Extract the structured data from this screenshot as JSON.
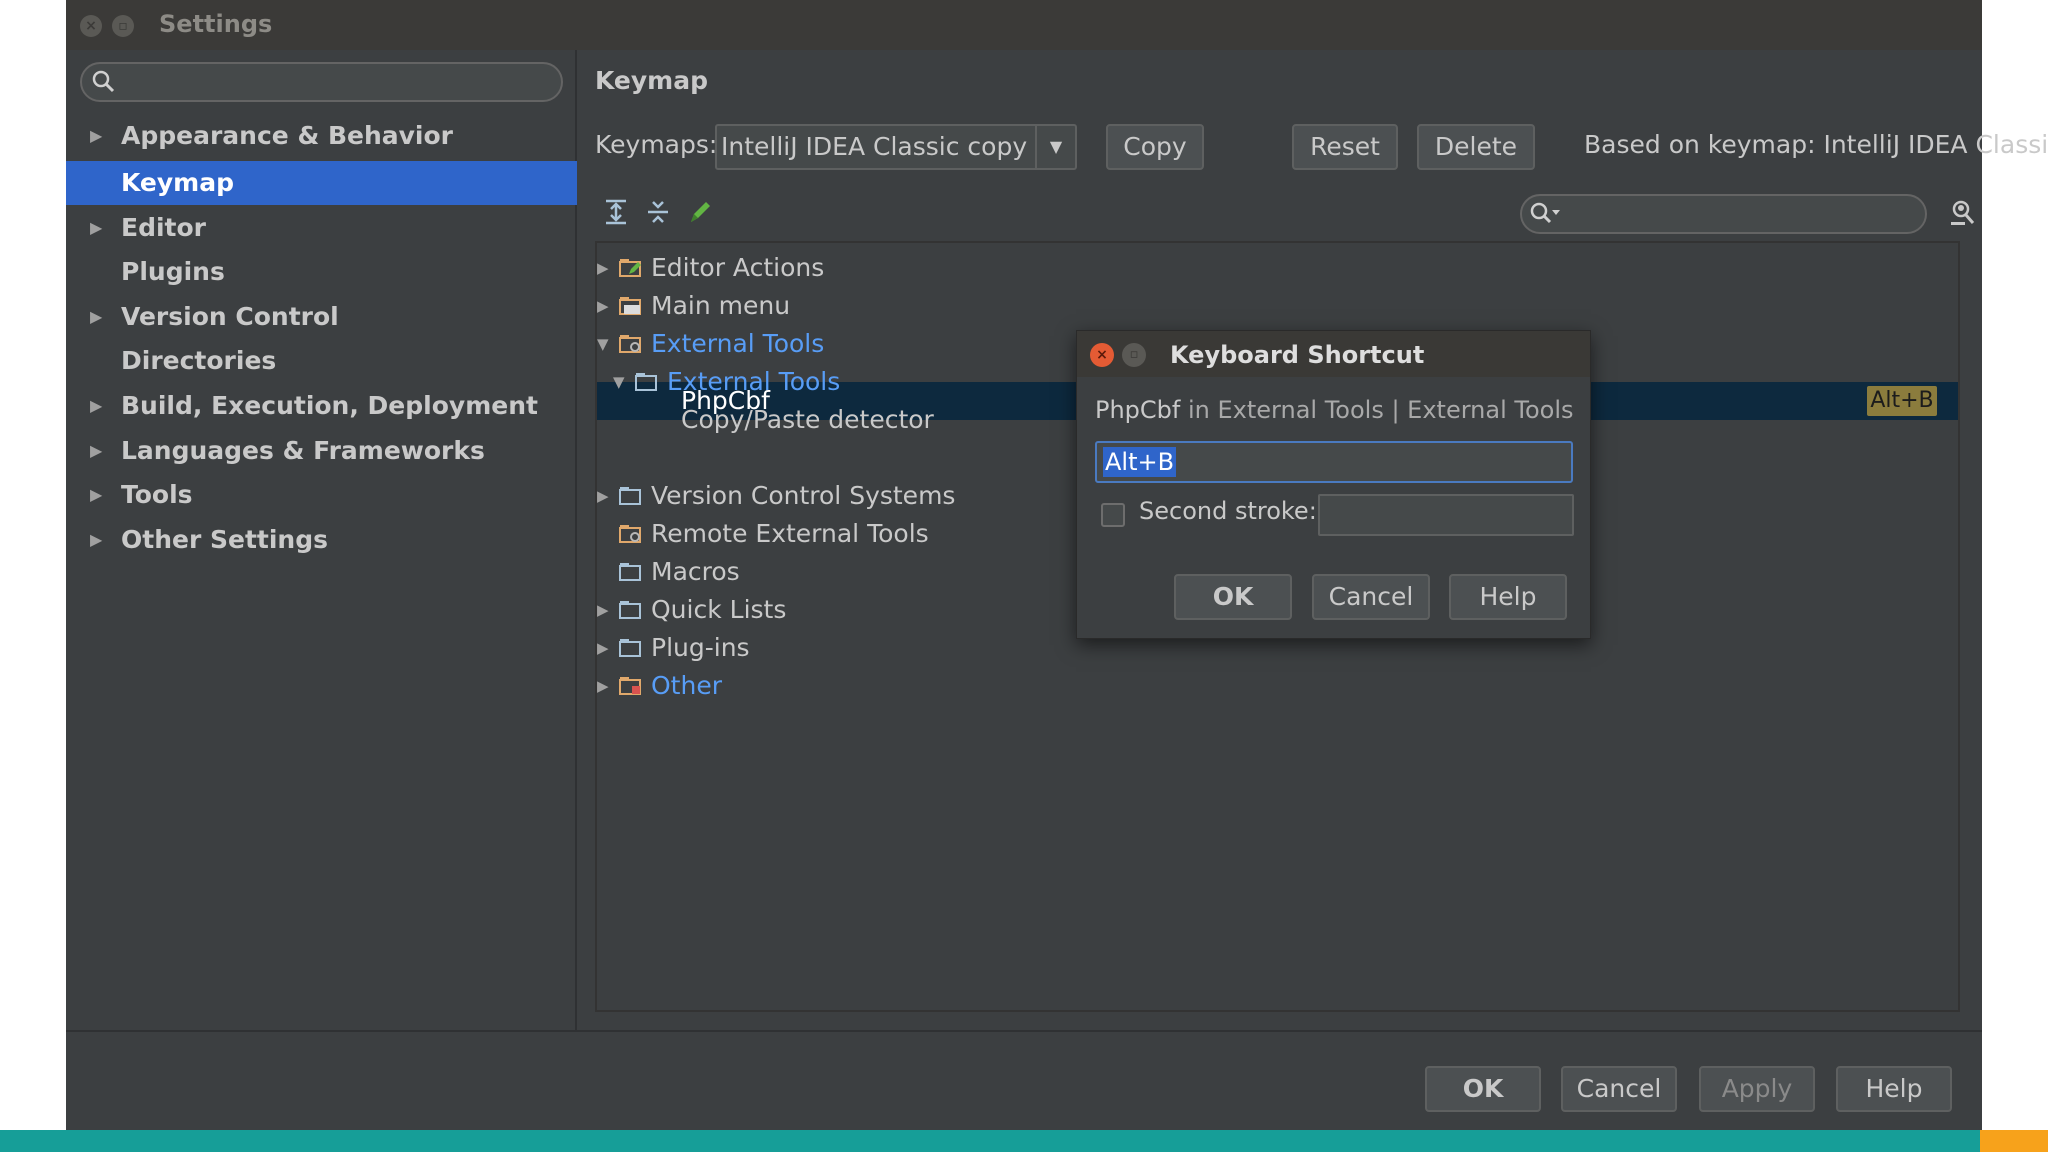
{
  "window": {
    "title": "Settings"
  },
  "sidebar": {
    "search_placeholder": "",
    "items": [
      {
        "label": "Appearance & Behavior",
        "expandable": true
      },
      {
        "label": "Keymap",
        "expandable": false,
        "selected": true
      },
      {
        "label": "Editor",
        "expandable": true
      },
      {
        "label": "Plugins",
        "expandable": false
      },
      {
        "label": "Version Control",
        "expandable": true
      },
      {
        "label": "Directories",
        "expandable": false
      },
      {
        "label": "Build, Execution, Deployment",
        "expandable": true
      },
      {
        "label": "Languages & Frameworks",
        "expandable": true
      },
      {
        "label": "Tools",
        "expandable": true
      },
      {
        "label": "Other Settings",
        "expandable": true
      }
    ]
  },
  "keymap": {
    "heading": "Keymap",
    "keymaps_label": "Keymaps:",
    "selected_keymap": "IntelliJ IDEA Classic copy",
    "copy_label": "Copy",
    "reset_label": "Reset",
    "delete_label": "Delete",
    "based_on": "Based on keymap: IntelliJ IDEA Classic",
    "tree": [
      {
        "label": "Editor Actions"
      },
      {
        "label": "Main menu"
      },
      {
        "label": "External Tools"
      },
      {
        "label": "External Tools"
      },
      {
        "label": "Copy/Paste detector"
      },
      {
        "label": "PhpCbf",
        "shortcut": "Alt+B"
      },
      {
        "label": "Version Control Systems"
      },
      {
        "label": "Remote External Tools"
      },
      {
        "label": "Macros"
      },
      {
        "label": "Quick Lists"
      },
      {
        "label": "Plug-ins"
      },
      {
        "label": "Other"
      }
    ]
  },
  "dialog": {
    "title": "Keyboard Shortcut",
    "action_name": "PhpCbf",
    "action_path": " in External Tools | External Tools",
    "first_stroke": "Alt+B",
    "second_stroke_label": "Second stroke:",
    "second_stroke_checked": false,
    "ok_label": "OK",
    "cancel_label": "Cancel",
    "help_label": "Help"
  },
  "footer": {
    "ok_label": "OK",
    "cancel_label": "Cancel",
    "apply_label": "Apply",
    "help_label": "Help"
  },
  "colors": {
    "selection": "#2f65ca",
    "link_blue": "#589df6",
    "accent_teal": "#169e98",
    "accent_orange": "#f7a21b"
  }
}
